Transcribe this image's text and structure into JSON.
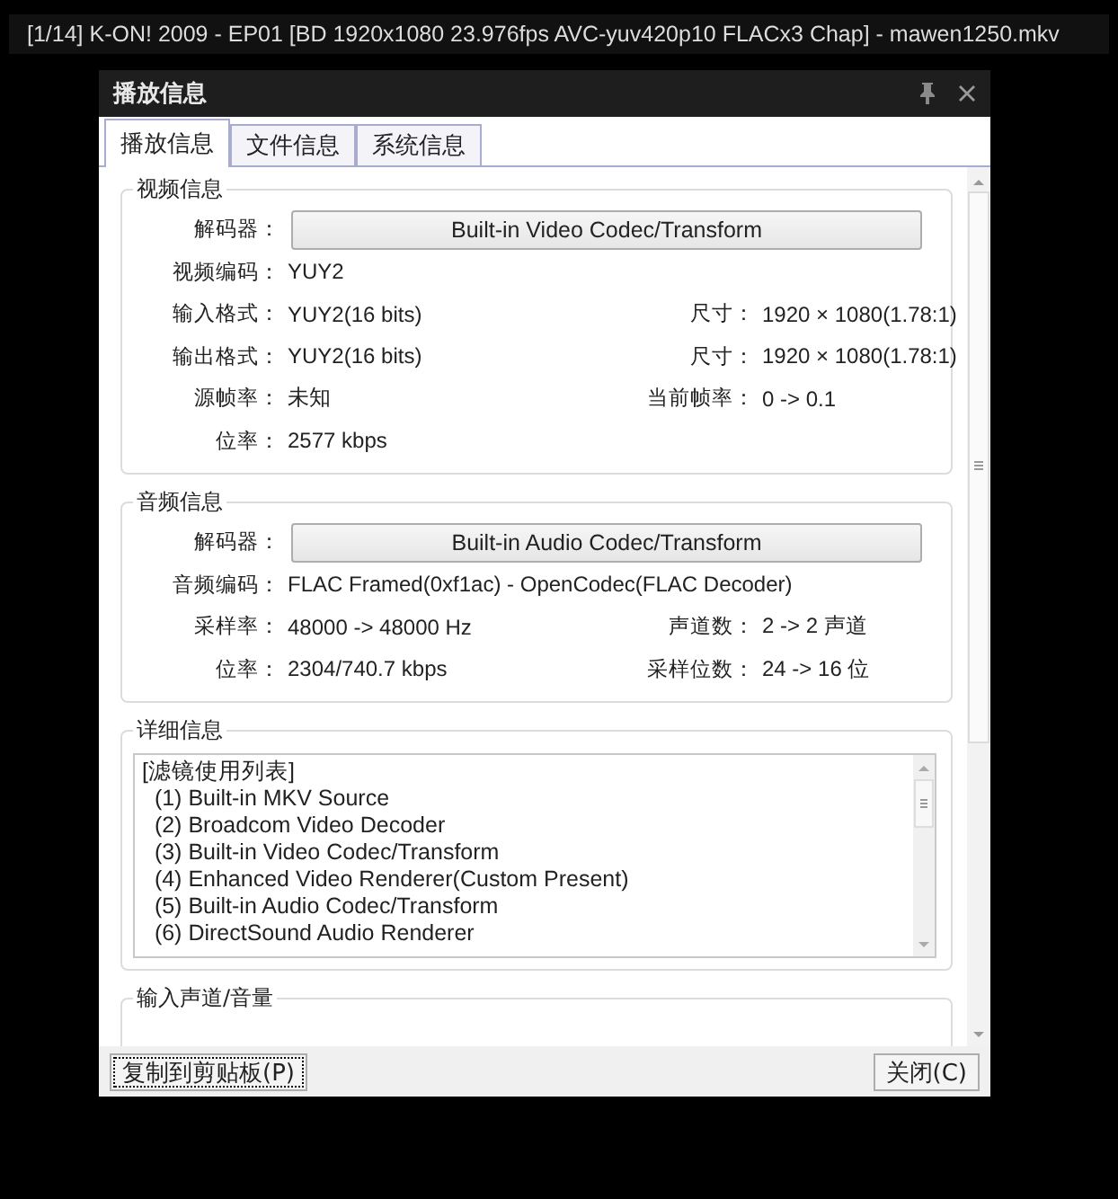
{
  "player_title": "[1/14] K-ON! 2009 - EP01 [BD 1920x1080 23.976fps AVC-yuv420p10 FLACx3 Chap] - mawen1250.mkv",
  "dialog": {
    "title": "播放信息"
  },
  "tabs": [
    {
      "label": "播放信息",
      "selected": true
    },
    {
      "label": "文件信息",
      "selected": false
    },
    {
      "label": "系统信息",
      "selected": false
    }
  ],
  "video": {
    "title": "视频信息",
    "decoder_label": "解码器：",
    "decoder": "Built-in Video Codec/Transform",
    "rows": [
      {
        "label": "视频编码：",
        "value": "YUY2"
      },
      {
        "label": "输入格式：",
        "value": "YUY2(16 bits)",
        "label2": "尺寸：",
        "value2": "1920 × 1080(1.78:1)"
      },
      {
        "label": "输出格式：",
        "value": "YUY2(16 bits)",
        "label2": "尺寸：",
        "value2": "1920 × 1080(1.78:1)"
      },
      {
        "label": "源帧率：",
        "value": "未知",
        "label2": "当前帧率：",
        "value2": "0 -> 0.1"
      },
      {
        "label": "位率：",
        "value": "2577 kbps"
      }
    ]
  },
  "audio": {
    "title": "音频信息",
    "decoder_label": "解码器：",
    "decoder": "Built-in Audio Codec/Transform",
    "rows": [
      {
        "label": "音频编码：",
        "value": "FLAC Framed(0xf1ac) - OpenCodec(FLAC Decoder)"
      },
      {
        "label": "采样率：",
        "value": "48000 -> 48000 Hz",
        "label2": "声道数：",
        "value2": "2 -> 2 声道"
      },
      {
        "label": "位率：",
        "value": "2304/740.7 kbps",
        "label2": "采样位数：",
        "value2": "24 -> 16 位"
      }
    ]
  },
  "details": {
    "title": "详细信息",
    "lines": [
      "[滤镜使用列表]",
      "  (1) Built-in MKV Source",
      "  (2) Broadcom Video Decoder",
      "  (3) Built-in Video Codec/Transform",
      "  (4) Enhanced Video Renderer(Custom Present)",
      "  (5) Built-in Audio Codec/Transform",
      "  (6) DirectSound Audio Renderer"
    ]
  },
  "input_channel": {
    "title": "输入声道/音量"
  },
  "buttons": {
    "copy": "复制到剪贴板(P)",
    "close": "关闭(C)"
  }
}
